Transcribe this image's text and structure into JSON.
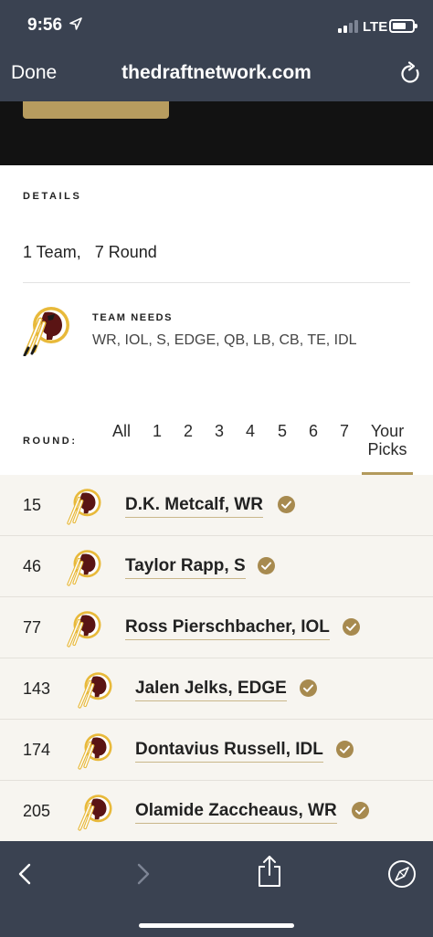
{
  "status_bar": {
    "time": "9:56",
    "network": "LTE",
    "icons": [
      "location-arrow-icon",
      "signal-icon",
      "battery-icon"
    ]
  },
  "browser": {
    "done_label": "Done",
    "url": "thedraftnetwork.com",
    "icons": [
      "reload-icon",
      "back-icon",
      "forward-icon",
      "share-icon",
      "compass-icon"
    ]
  },
  "details": {
    "label": "DETAILS",
    "value": "1 Team,   7 Round"
  },
  "team_needs": {
    "label": "TEAM NEEDS",
    "value": "WR, IOL, S, EDGE, QB, LB, CB, TE, IDL",
    "logo_icon": "team-logo-icon"
  },
  "rounds": {
    "label": "ROUND:",
    "tabs": [
      "All",
      "1",
      "2",
      "3",
      "4",
      "5",
      "6",
      "7"
    ],
    "your_picks_line1": "Your",
    "your_picks_line2": "Picks",
    "selected": "Your Picks"
  },
  "picks": [
    {
      "number": "15",
      "name": "D.K. Metcalf, WR"
    },
    {
      "number": "46",
      "name": "Taylor Rapp, S"
    },
    {
      "number": "77",
      "name": "Ross Pierschbacher, IOL"
    },
    {
      "number": "143",
      "name": "Jalen Jelks, EDGE"
    },
    {
      "number": "174",
      "name": "Dontavius Russell, IDL"
    },
    {
      "number": "205",
      "name": "Olamide Zaccheaus, WR"
    }
  ],
  "colors": {
    "chrome": "#3a4251",
    "accent_gold": "#b79c5f",
    "check_gold": "#a78a4f",
    "list_bg": "#f7f5f0",
    "logo_burgundy": "#5a1414",
    "logo_gold": "#e8b93a"
  }
}
